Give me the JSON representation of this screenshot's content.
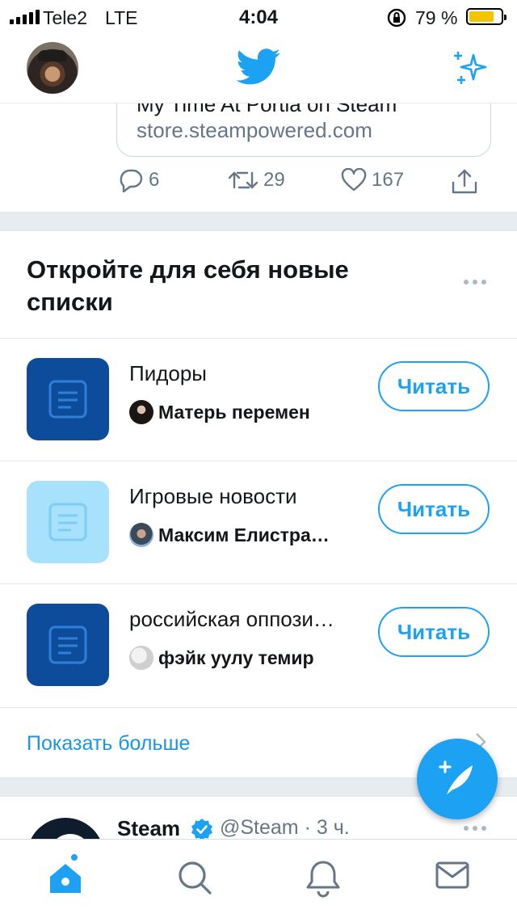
{
  "status_bar": {
    "carrier": "Tele2",
    "network": "LTE",
    "time": "4:04",
    "battery_percent": "79 %",
    "battery_level": 0.79
  },
  "header": {
    "logo_icon": "twitter-bird-icon",
    "sparkle_icon": "sparkle-icon"
  },
  "previous_tweet": {
    "card_title": "My Time At Portia on Steam",
    "card_domain": "store.steampowered.com",
    "replies": "6",
    "retweets": "29",
    "likes": "167"
  },
  "lists_module": {
    "title": "Откройте для себя новые списки",
    "lists": [
      {
        "name": "Пидоры",
        "owner": "Матерь перемен",
        "icon_color": "#0d4c9b",
        "button": "Читать"
      },
      {
        "name": "Игровые новости",
        "owner": "Максим Елистра…",
        "icon_color": "#a7e1fb",
        "button": "Читать"
      },
      {
        "name": "российская оппози…",
        "owner": "фэйк уулу темир",
        "icon_color": "#0d4c9b",
        "button": "Читать"
      }
    ],
    "show_more": "Показать больше"
  },
  "next_tweet": {
    "name": "Steam",
    "handle_time": "@Steam · 3 ч."
  },
  "colors": {
    "accent": "#1da1f2",
    "link": "#1b95e0",
    "secondary_text": "#657786"
  }
}
